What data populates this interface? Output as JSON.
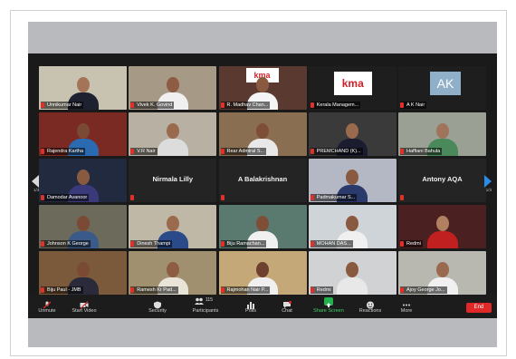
{
  "meeting": {
    "pagination": {
      "left": "1/3",
      "right": "1/3"
    },
    "tiles": [
      {
        "name": "Unnikumar Nair",
        "bg": "#c8c2b0",
        "skin": "#a57458",
        "shirt": "#1e2230",
        "active": true
      },
      {
        "name": "Vivek K. Govind",
        "bg": "#a69a87",
        "skin": "#8e5c42",
        "shirt": "#f0f0f0"
      },
      {
        "name": "R. Madhav Chan...",
        "bg": "#5a3a30",
        "skin": "#8a5a40",
        "shirt": "#f4f4f4",
        "logo": "kma"
      },
      {
        "name": "Kerala Managem...",
        "bg": "#1e1e1e",
        "logo": "kma"
      },
      {
        "name": "A K Nair",
        "bg": "#1e1e1e",
        "initials": "AK"
      },
      {
        "name": "Rajendra Kartha",
        "bg": "#7a2a22",
        "skin": "#7a4a34",
        "shirt": "#2a6ab0"
      },
      {
        "name": "V.R Nair",
        "bg": "#b8b0a2",
        "skin": "#9a6a4e",
        "shirt": "#dcdcdc"
      },
      {
        "name": "Rear Admiral S...",
        "bg": "#8a6e52",
        "skin": "#7e4e36",
        "shirt": "#e8e8e8"
      },
      {
        "name": "PREMCHAND (K)...",
        "bg": "#3a3a3a",
        "skin": "#9a6a4e",
        "shirt": "#1c1c30"
      },
      {
        "name": "Haffiani Bahula",
        "bg": "#9aa094",
        "skin": "#a0745a",
        "shirt": "#4a8a5a"
      },
      {
        "name": "Damodar Avanoor",
        "bg": "#222a40",
        "skin": "#8a5a40",
        "shirt": "#3a3a7a"
      },
      {
        "nameonly": "Nirmala Lilly"
      },
      {
        "nameonly": "A Balakrishnan"
      },
      {
        "name": "Padmakumar S...",
        "bg": "#b4b8c4",
        "skin": "#8a5a40",
        "shirt": "#2a3a6a"
      },
      {
        "nameonly": "Antony AQA"
      },
      {
        "name": "Johnson K George",
        "bg": "#6c6a5a",
        "skin": "#7a4a34",
        "shirt": "#3a5a8a"
      },
      {
        "name": "Dinesh Thampi",
        "bg": "#c0b8a6",
        "skin": "#9a6a4e",
        "shirt": "#2a4a8a"
      },
      {
        "name": "Biju Ramachan...",
        "bg": "#5a7a70",
        "skin": "#7e4e36",
        "shirt": "#f0f0f0"
      },
      {
        "name": "MOHAN DAS...",
        "bg": "#cfd4d8",
        "skin": "#8a5a40",
        "shirt": "#f0f0f0"
      },
      {
        "name": "Redmi",
        "bg": "#4a2020",
        "skin": "#b08060",
        "shirt": "#c02020"
      },
      {
        "name": "Biju Paul - JMB",
        "bg": "#7a5a3a",
        "skin": "#7a4a34",
        "shirt": "#2a2a3a"
      },
      {
        "name": "Ramesh Kr Pad...",
        "bg": "#a09070",
        "skin": "#8e5c42",
        "shirt": "#e8e4d8"
      },
      {
        "name": "Rajmohan Nair P...",
        "bg": "#c4a878",
        "skin": "#6e4030",
        "shirt": "#f0f0f0"
      },
      {
        "name": "Redmi",
        "bg": "#d0d2d4",
        "skin": "#8a5a40",
        "shirt": "#e8e8e8"
      },
      {
        "name": "Ajoy George Jo...",
        "bg": "#b8b8b0",
        "skin": "#9a6a4e",
        "shirt": "#f0f0f0"
      }
    ]
  },
  "toolbar": {
    "unmute": "Unmute",
    "start_video": "Start Video",
    "security": "Security",
    "participants": "Participants",
    "participants_count": "115",
    "polls": "Polls",
    "chat": "Chat",
    "share_screen": "Share Screen",
    "reactions": "Reactions",
    "more": "More",
    "end": "End"
  },
  "colors": {
    "accent": "#2b8ce8",
    "end": "#e02828",
    "share": "#22b14c",
    "active_speaker": "#f2d400"
  }
}
